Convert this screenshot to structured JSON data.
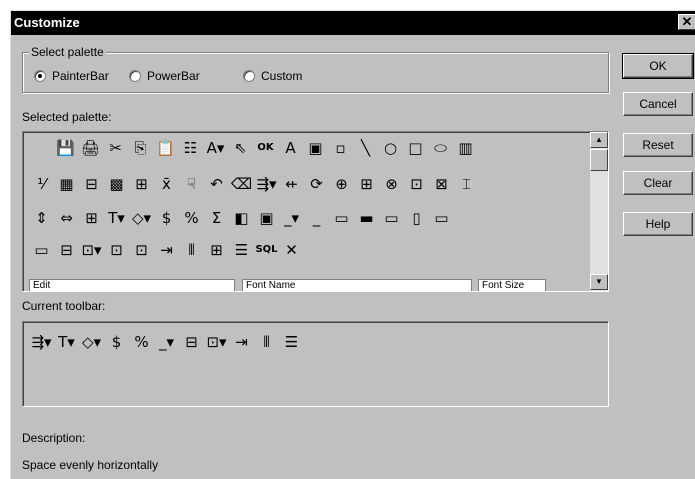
{
  "window": {
    "title": "Customize",
    "close_glyph": "✕"
  },
  "select_palette": {
    "legend": "Select palette",
    "options": [
      {
        "label": "PainterBar",
        "checked": true
      },
      {
        "label": "PowerBar",
        "checked": false
      },
      {
        "label": "Custom",
        "checked": false
      }
    ]
  },
  "selected_palette": {
    "label": "Selected palette:",
    "rows": [
      [
        "💾",
        "🖨",
        "✂",
        "⎘",
        "📋",
        "☷",
        "A▾",
        "⇖",
        "OK",
        "A",
        "▣",
        "▫",
        "╲",
        "○",
        "□",
        "⬭",
        "▥"
      ],
      [
        "⅟",
        "▦",
        "⊟",
        "▩",
        "⊞",
        "x̄",
        "☟",
        "↶",
        "⌫",
        "⇶▾",
        "⇷",
        "⟳",
        "⊕",
        "⊞",
        "⊗",
        "⊡",
        "⊠",
        "⌶"
      ],
      [
        "⇕",
        "⇔",
        "⊞",
        "T▾",
        "◇▾",
        "$",
        "%",
        "Σ",
        "◧",
        "▣",
        "_▾",
        "_",
        "▭",
        "▬",
        "▭",
        "▯",
        "▭"
      ],
      [
        "▭",
        "⊟",
        "⊡▾",
        "⊡",
        "⊡",
        "⇥",
        "⦀",
        "⊞",
        "☰",
        "SQL",
        "✕"
      ]
    ],
    "combos": [
      "Edit",
      "Font Name",
      "Font Size"
    ],
    "scroll_up": "▲",
    "scroll_down": "▼"
  },
  "current_toolbar": {
    "label": "Current toolbar:",
    "icons": [
      "⇶▾",
      "T▾",
      "◇▾",
      "$",
      "%",
      "_▾",
      "⊟",
      "⊡▾",
      "⇥",
      "⦀",
      "☰"
    ]
  },
  "buttons": {
    "ok": "OK",
    "cancel": "Cancel",
    "reset": "Reset",
    "clear": "Clear",
    "help": "Help"
  },
  "description": {
    "label": "Description:",
    "text": "Space evenly horizontally"
  }
}
